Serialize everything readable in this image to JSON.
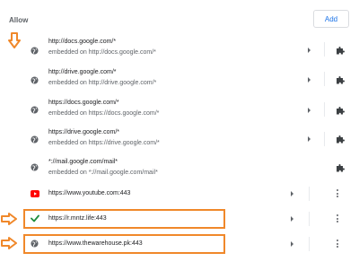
{
  "section": {
    "title": "Allow",
    "add_label": "Add"
  },
  "colors": {
    "accent": "#1a73e8",
    "annotation": "#f0882a",
    "check": "#1e8e3e",
    "youtube": "#ff0000"
  },
  "rows": [
    {
      "url": "http://docs.google.com/*",
      "embedded": "embedded on http://docs.google.com/*",
      "icon": "globe-icon",
      "action": "extension-icon"
    },
    {
      "url": "http://drive.google.com/*",
      "embedded": "embedded on http://drive.google.com/*",
      "icon": "globe-icon",
      "action": "extension-icon"
    },
    {
      "url": "https://docs.google.com/*",
      "embedded": "embedded on https://docs.google.com/*",
      "icon": "globe-icon",
      "action": "extension-icon"
    },
    {
      "url": "https://drive.google.com/*",
      "embedded": "embedded on https://drive.google.com/*",
      "icon": "globe-icon",
      "action": "extension-icon"
    },
    {
      "url": "*://mail.google.com/mail*",
      "embedded": "embedded on *://mail.google.com/mail*",
      "icon": "globe-icon",
      "action": "extension-icon"
    },
    {
      "url": "https://www.youtube.com:443",
      "icon": "youtube-icon",
      "action": "more-icon"
    },
    {
      "url": "https://r.mntz.life:443",
      "icon": "check-icon",
      "action": "more-icon",
      "highlighted": true
    },
    {
      "url": "https://www.thewarehouse.pk:443",
      "icon": "globe-icon",
      "action": "more-icon",
      "highlighted": true
    }
  ]
}
